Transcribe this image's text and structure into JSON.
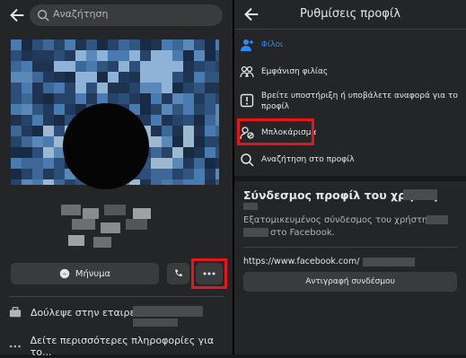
{
  "left": {
    "search": {
      "placeholder": "Αναζήτηση"
    },
    "actions": {
      "message_label": "Μήνυμα"
    },
    "info": [
      {
        "text": "Δούλεψε στην εταιρεία"
      },
      {
        "text": "Δείτε περισσότερες πληροφορίες για το..."
      }
    ]
  },
  "right": {
    "title": "Ρυθμίσεις προφίλ",
    "menu": [
      {
        "label": "Φίλοι",
        "color": "#2d88ff"
      },
      {
        "label": "Εμφάνιση φιλίας"
      },
      {
        "label": "Βρείτε υποστήριξη ή υποβάλετε αναφορά για το",
        "label2": "προφίλ"
      },
      {
        "label": "Μπλοκάρισμα"
      },
      {
        "label": "Αναζήτηση στο προφίλ"
      }
    ],
    "link_section": {
      "title": "Σύνδεσμος προφίλ του χρήστη",
      "desc_line1": "Εξατομικευμένος σύνδεσμος του χρήστη",
      "desc_line2": "στο Facebook.",
      "url": "https://www.facebook.com/",
      "copy_label": "Αντιγραφή συνδέσμου"
    }
  },
  "colors": {
    "highlight": "#e8141b",
    "accent": "#2d88ff"
  }
}
